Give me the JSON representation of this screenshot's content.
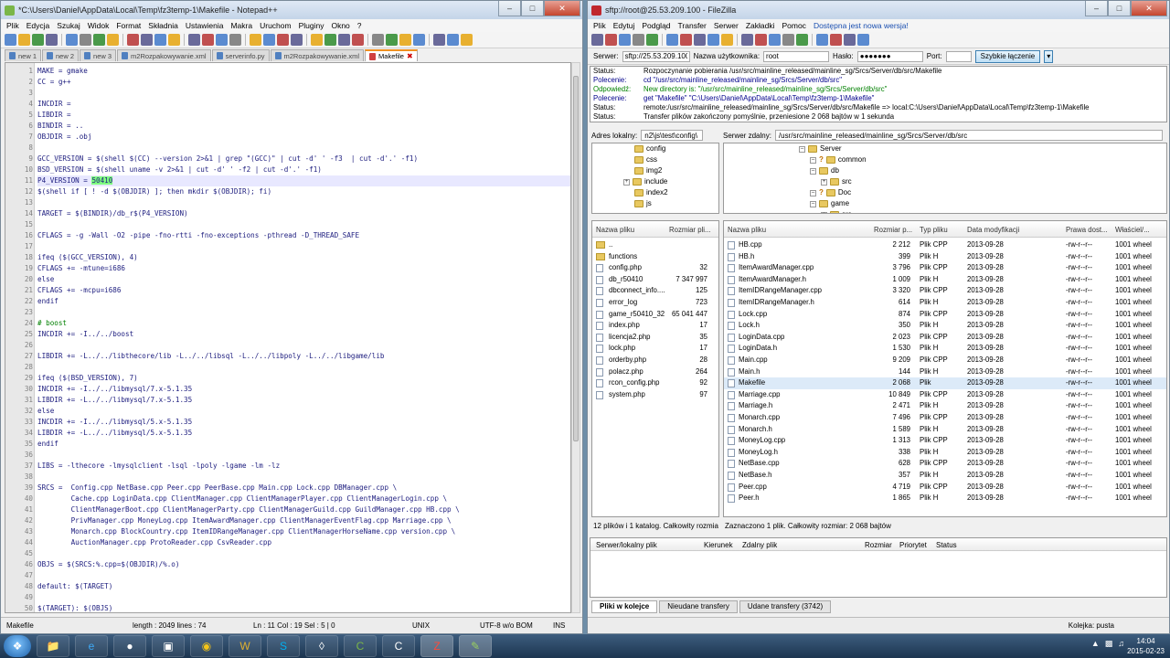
{
  "npp": {
    "title": "*C:\\Users\\Daniel\\AppData\\Local\\Temp\\fz3temp-1\\Makefile - Notepad++",
    "menu": [
      "Plik",
      "Edycja",
      "Szukaj",
      "Widok",
      "Format",
      "Składnia",
      "Ustawienia",
      "Makra",
      "Uruchom",
      "Pluginy",
      "Okno",
      "?"
    ],
    "tabs": [
      {
        "label": "new 1",
        "active": false
      },
      {
        "label": "new 2",
        "active": false
      },
      {
        "label": "new 3",
        "active": false
      },
      {
        "label": "m2Rozpakowywanie.xml",
        "active": false
      },
      {
        "label": "serverinfo.py",
        "active": false
      },
      {
        "label": "m2Rozpakowywanie.xml",
        "active": false
      },
      {
        "label": "Makefile",
        "active": true
      }
    ],
    "lines": [
      "MAKE = gmake",
      "CC = g++",
      "",
      "INCDIR =",
      "LIBDIR =",
      "BINDIR = ..",
      "OBJDIR = .obj",
      "",
      "GCC_VERSION = $(shell $(CC) --version 2>&1 | grep \"(GCC)\" | cut -d' ' -f3  | cut -d'.' -f1)",
      "BSD_VERSION = $(shell uname -v 2>&1 | cut -d' ' -f2 | cut -d'.' -f1)",
      "P4_VERSION = 50410",
      "$(shell if [ ! -d $(OBJDIR) ]; then mkdir $(OBJDIR); fi)",
      "",
      "TARGET = $(BINDIR)/db_r$(P4_VERSION)",
      "",
      "CFLAGS = -g -Wall -O2 -pipe -fno-rtti -fno-exceptions -pthread -D_THREAD_SAFE",
      "",
      "ifeq ($(GCC_VERSION), 4)",
      "CFLAGS += -mtune=i686",
      "else",
      "CFLAGS += -mcpu=i686",
      "endif",
      "",
      "# boost",
      "INCDIR += -I../../boost",
      "",
      "LIBDIR += -L../../libthecore/lib -L../../libsql -L../../libpoly -L../../libgame/lib",
      "",
      "ifeq ($(BSD_VERSION), 7)",
      "INCDIR += -I../../libmysql/7.x-5.1.35",
      "LIBDIR += -L../../libmysql/7.x-5.1.35",
      "else",
      "INCDIR += -I../../libmysql/5.x-5.1.35",
      "LIBDIR += -L../../libmysql/5.x-5.1.35",
      "endif",
      "",
      "LIBS = -lthecore -lmysqlclient -lsql -lpoly -lgame -lm -lz",
      "",
      "SRCS =  Config.cpp NetBase.cpp Peer.cpp PeerBase.cpp Main.cpp Lock.cpp DBManager.cpp \\",
      "        Cache.cpp LoginData.cpp ClientManager.cpp ClientManagerPlayer.cpp ClientManagerLogin.cpp \\",
      "        ClientManagerBoot.cpp ClientManagerParty.cpp ClientManagerGuild.cpp GuildManager.cpp HB.cpp \\",
      "        PrivManager.cpp MoneyLog.cpp ItemAwardManager.cpp ClientManagerEventFlag.cpp Marriage.cpp \\",
      "        Monarch.cpp BlockCountry.cpp ItemIDRangeManager.cpp ClientManagerHorseName.cpp version.cpp \\",
      "        AuctionManager.cpp ProtoReader.cpp CsvReader.cpp",
      "",
      "OBJS = $(SRCS:%.cpp=$(OBJDIR)/%.o)",
      "",
      "default: $(TARGET)",
      "",
      "$(TARGET): $(OBJS)"
    ],
    "highlight": "50410",
    "status": {
      "type": "Makefile",
      "length": "length : 2049   lines : 74",
      "pos": "Ln : 11   Col : 19   Sel : 5 | 0",
      "eol": "UNIX",
      "enc": "UTF-8 w/o BOM",
      "ins": "INS"
    }
  },
  "fz": {
    "title": "sftp://root@25.53.209.100 - FileZilla",
    "menu": [
      "Plik",
      "Edytuj",
      "Podgląd",
      "Transfer",
      "Serwer",
      "Zakładki",
      "Pomoc",
      "Dostępna jest nowa wersja!"
    ],
    "qc": {
      "host_label": "Serwer:",
      "host": "sftp://25.53.209.100",
      "user_label": "Nazwa użytkownika:",
      "user": "root",
      "pass_label": "Hasło:",
      "pass": "●●●●●●●",
      "port_label": "Port:",
      "port": "",
      "button": "Szybkie łączenie"
    },
    "log": [
      {
        "k": "Status:",
        "v": "Rozpoczynanie pobierania /usr/src/mainline_released/mainline_sg/Srcs/Server/db/src/Makefile",
        "c": "#000"
      },
      {
        "k": "Polecenie:",
        "v": "cd \"/usr/src/mainline_released/mainline_sg/Srcs/Server/db/src\"",
        "c": "#00008b"
      },
      {
        "k": "Odpowiedź:",
        "v": "New directory is: \"/usr/src/mainline_released/mainline_sg/Srcs/Server/db/src\"",
        "c": "#008000"
      },
      {
        "k": "Polecenie:",
        "v": "get \"Makefile\" \"C:\\Users\\Daniel\\AppData\\Local\\Temp\\fz3temp-1\\Makefile\"",
        "c": "#00008b"
      },
      {
        "k": "Status:",
        "v": "remote:/usr/src/mainline_released/mainline_sg/Srcs/Server/db/src/Makefile => local:C:\\Users\\Daniel\\AppData\\Local\\Temp\\fz3temp-1\\Makefile",
        "c": "#000"
      },
      {
        "k": "Status:",
        "v": "Transfer plików zakończony pomyślnie, przeniesione 2 068 bajtów w 1 sekunda",
        "c": "#000"
      }
    ],
    "local_label": "Adres lokalny:",
    "local_path": "n2\\js\\test\\config\\",
    "remote_label": "Serwer zdalny:",
    "remote_path": "/usr/src/mainline_released/mainline_sg/Srcs/Server/db/src",
    "local_tree": [
      "config",
      "css",
      "img2",
      "include",
      "index2",
      "js"
    ],
    "remote_tree": [
      {
        "name": "Server",
        "d": 0
      },
      {
        "name": "common",
        "d": 1,
        "q": true
      },
      {
        "name": "db",
        "d": 1
      },
      {
        "name": "src",
        "d": 2
      },
      {
        "name": "Doc",
        "d": 1,
        "q": true
      },
      {
        "name": "game",
        "d": 1
      },
      {
        "name": "src",
        "d": 2
      }
    ],
    "local_head": {
      "name": "Nazwa pliku",
      "size": "Rozmiar pli..."
    },
    "local_files": [
      {
        "n": "..",
        "s": "",
        "dir": true
      },
      {
        "n": "functions",
        "s": "",
        "dir": true
      },
      {
        "n": "config.php",
        "s": "32"
      },
      {
        "n": "db_r50410",
        "s": "7 347 997"
      },
      {
        "n": "dbconnect_info....",
        "s": "125"
      },
      {
        "n": "error_log",
        "s": "723"
      },
      {
        "n": "game_r50410_32",
        "s": "65 041 447"
      },
      {
        "n": "index.php",
        "s": "17"
      },
      {
        "n": "licencja2.php",
        "s": "35"
      },
      {
        "n": "lock.php",
        "s": "17"
      },
      {
        "n": "orderby.php",
        "s": "28"
      },
      {
        "n": "polacz.php",
        "s": "264"
      },
      {
        "n": "rcon_config.php",
        "s": "92"
      },
      {
        "n": "system.php",
        "s": "97"
      }
    ],
    "remote_head": {
      "name": "Nazwa pliku",
      "size": "Rozmiar p...",
      "type": "Typ pliku",
      "date": "Data modyfikacji",
      "perm": "Prawa dost...",
      "owner": "Właściel/..."
    },
    "remote_files": [
      {
        "n": "HB.cpp",
        "s": "2 212",
        "t": "Plik CPP"
      },
      {
        "n": "HB.h",
        "s": "399",
        "t": "Plik H"
      },
      {
        "n": "ItemAwardManager.cpp",
        "s": "3 796",
        "t": "Plik CPP"
      },
      {
        "n": "ItemAwardManager.h",
        "s": "1 009",
        "t": "Plik H"
      },
      {
        "n": "ItemIDRangeManager.cpp",
        "s": "3 320",
        "t": "Plik CPP"
      },
      {
        "n": "ItemIDRangeManager.h",
        "s": "614",
        "t": "Plik H"
      },
      {
        "n": "Lock.cpp",
        "s": "874",
        "t": "Plik CPP"
      },
      {
        "n": "Lock.h",
        "s": "350",
        "t": "Plik H"
      },
      {
        "n": "LoginData.cpp",
        "s": "2 023",
        "t": "Plik CPP"
      },
      {
        "n": "LoginData.h",
        "s": "1 530",
        "t": "Plik H"
      },
      {
        "n": "Main.cpp",
        "s": "9 209",
        "t": "Plik CPP"
      },
      {
        "n": "Main.h",
        "s": "144",
        "t": "Plik H"
      },
      {
        "n": "Makefile",
        "s": "2 068",
        "t": "Plik",
        "sel": true
      },
      {
        "n": "Marriage.cpp",
        "s": "10 849",
        "t": "Plik CPP"
      },
      {
        "n": "Marriage.h",
        "s": "2 471",
        "t": "Plik H"
      },
      {
        "n": "Monarch.cpp",
        "s": "7 496",
        "t": "Plik CPP"
      },
      {
        "n": "Monarch.h",
        "s": "1 589",
        "t": "Plik H"
      },
      {
        "n": "MoneyLog.cpp",
        "s": "1 313",
        "t": "Plik CPP"
      },
      {
        "n": "MoneyLog.h",
        "s": "338",
        "t": "Plik H"
      },
      {
        "n": "NetBase.cpp",
        "s": "628",
        "t": "Plik CPP"
      },
      {
        "n": "NetBase.h",
        "s": "357",
        "t": "Plik H"
      },
      {
        "n": "Peer.cpp",
        "s": "4 719",
        "t": "Plik CPP"
      },
      {
        "n": "Peer.h",
        "s": "1 865",
        "t": "Plik H"
      }
    ],
    "remote_date": "2013-09-28",
    "remote_perm": "-rw-r--r--",
    "remote_owner": "1001 wheel",
    "local_status": "12 plików i 1 katalog. Całkowity rozmia",
    "remote_status": "Zaznaczono 1 plik. Całkowity rozmiar: 2 068 bajtów",
    "queue_head": [
      "Serwer/lokalny plik",
      "Kierunek",
      "Zdalny plik",
      "Rozmiar",
      "Priorytet",
      "Status"
    ],
    "queue_tabs": [
      "Pliki w kolejce",
      "Nieudane transfery",
      "Udane transfery (3742)"
    ],
    "queue_status": "Kolejka: pusta"
  },
  "taskbar": {
    "time": "14:04",
    "date": "2015-02-23"
  }
}
